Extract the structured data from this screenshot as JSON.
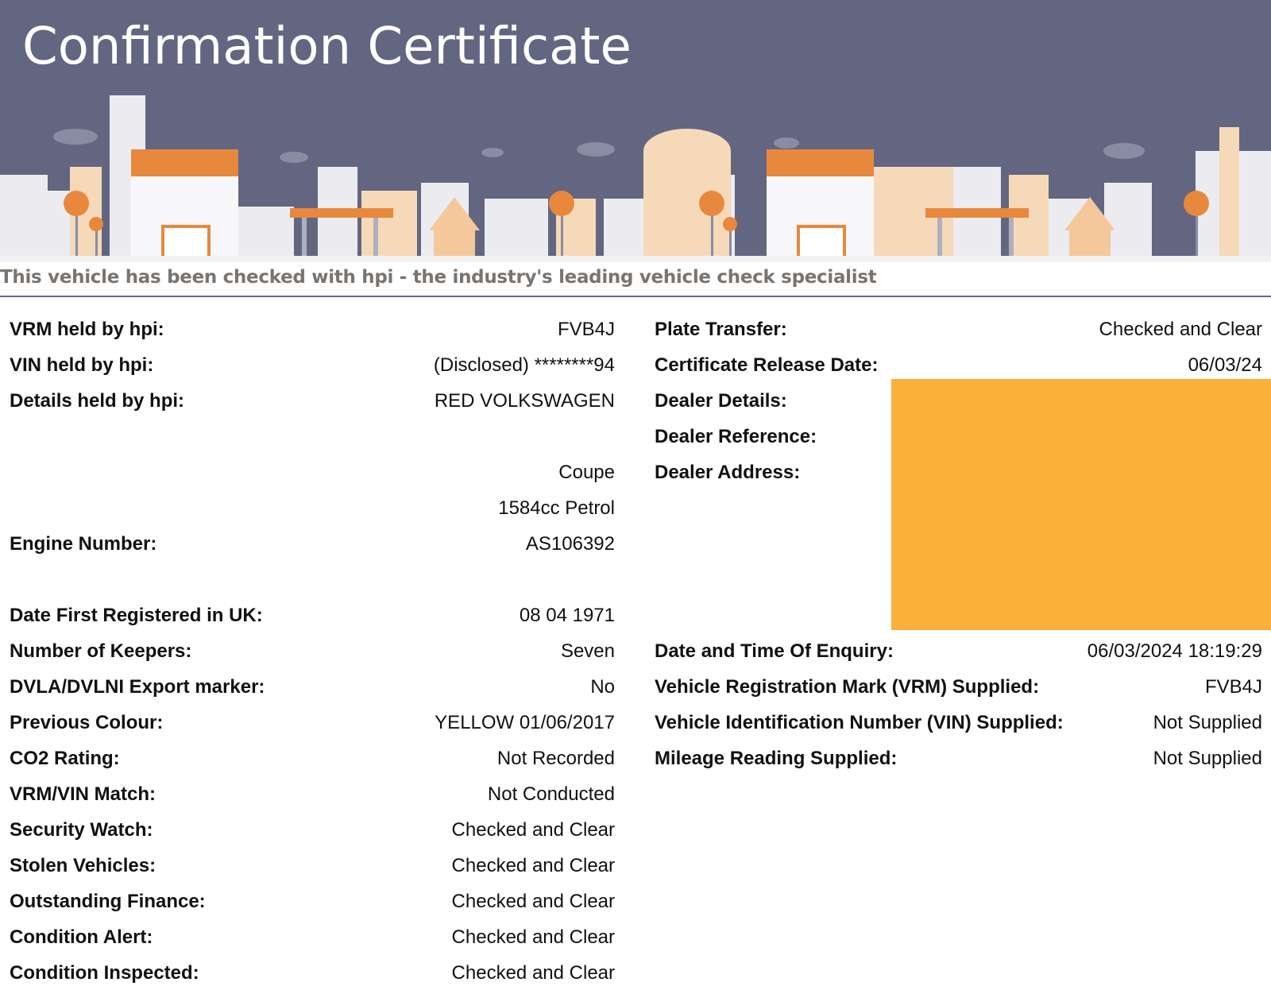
{
  "header": {
    "title": "Confirmation Certificate",
    "tagline": "This vehicle has been checked with hpi - the industry's leading vehicle check specialist",
    "colors": {
      "banner": "#636681",
      "accent_orange": "#e8883c",
      "tagline": "#7a7470"
    }
  },
  "left_fields": [
    {
      "label": "VRM held by hpi:",
      "value": "FVB4J"
    },
    {
      "label": "VIN held by hpi:",
      "value": "(Disclosed) ********94"
    },
    {
      "label": "Details held by hpi:",
      "value": "RED VOLKSWAGEN"
    },
    {
      "label": "",
      "value": "Coupe"
    },
    {
      "label": "",
      "value": "1584cc Petrol"
    },
    {
      "label": "Engine Number:",
      "value": "AS106392"
    },
    {
      "label": "Date First Registered in UK:",
      "value": "08 04 1971"
    },
    {
      "label": "Number of Keepers:",
      "value": "Seven"
    },
    {
      "label": "DVLA/DVLNI Export marker:",
      "value": "No"
    },
    {
      "label": "Previous Colour:",
      "value": "YELLOW 01/06/2017"
    },
    {
      "label": "CO2 Rating:",
      "value": "Not Recorded"
    },
    {
      "label": "VRM/VIN Match:",
      "value": "Not Conducted"
    },
    {
      "label": "Security Watch:",
      "value": "Checked and Clear"
    },
    {
      "label": "Stolen Vehicles:",
      "value": "Checked and Clear"
    },
    {
      "label": "Outstanding Finance:",
      "value": "Checked and Clear"
    },
    {
      "label": "Condition Alert:",
      "value": "Checked and Clear"
    },
    {
      "label": "Condition Inspected:",
      "value": "Checked and Clear"
    }
  ],
  "right_fields": [
    {
      "label": "Plate Transfer:",
      "value": "Checked and Clear"
    },
    {
      "label": "Certificate Release Date:",
      "value": "06/03/24"
    },
    {
      "label": "Dealer Details:",
      "value": ""
    },
    {
      "label": "Dealer Reference:",
      "value": ""
    },
    {
      "label": "Dealer Address:",
      "value": ""
    },
    {
      "label": "Date and Time Of Enquiry:",
      "value": "06/03/2024 18:19:29"
    },
    {
      "label": "Vehicle Registration Mark (VRM) Supplied:",
      "value": "FVB4J"
    },
    {
      "label": "Vehicle Identification Number (VIN) Supplied:",
      "value": "Not Supplied"
    },
    {
      "label": "Mileage Reading Supplied:",
      "value": "Not Supplied"
    }
  ],
  "redaction": {
    "color": "#fbb03b"
  }
}
